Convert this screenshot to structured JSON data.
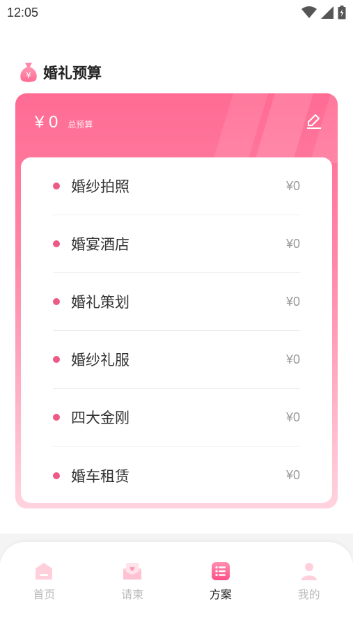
{
  "status_bar": {
    "time": "12:05"
  },
  "section": {
    "title": "婚礼预算"
  },
  "budget": {
    "currency": "¥",
    "total": "0",
    "total_label": "总预算",
    "items": [
      {
        "label": "婚纱拍照",
        "value": "¥0"
      },
      {
        "label": "婚宴酒店",
        "value": "¥0"
      },
      {
        "label": "婚礼策划",
        "value": "¥0"
      },
      {
        "label": "婚纱礼服",
        "value": "¥0"
      },
      {
        "label": "四大金刚",
        "value": "¥0"
      },
      {
        "label": "婚车租赁",
        "value": "¥0"
      }
    ]
  },
  "nav": {
    "items": [
      {
        "label": "首页",
        "icon": "home-icon",
        "active": false
      },
      {
        "label": "请柬",
        "icon": "invitation-icon",
        "active": false
      },
      {
        "label": "方案",
        "icon": "plan-list-icon",
        "active": true
      },
      {
        "label": "我的",
        "icon": "profile-icon",
        "active": false
      }
    ]
  },
  "colors": {
    "accent": "#ff6b93",
    "dot": "#ee5a86",
    "inactive": "#bbbbbb"
  }
}
